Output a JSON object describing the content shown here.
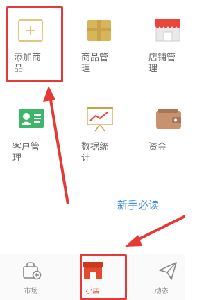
{
  "grid": {
    "items": [
      {
        "label": "添加商品",
        "icon": "add-product-icon"
      },
      {
        "label": "商品管理",
        "icon": "box-icon"
      },
      {
        "label": "店铺管理",
        "icon": "shop-icon"
      },
      {
        "label": "客户管理",
        "icon": "contact-card-icon"
      },
      {
        "label": "数据统计",
        "icon": "chart-icon"
      },
      {
        "label": "资金",
        "icon": "wallet-icon"
      }
    ]
  },
  "guide_link": "新手必读",
  "tabs": [
    {
      "label": "市场",
      "icon": "market-bag-icon",
      "active": false
    },
    {
      "label": "小店",
      "icon": "shop-icon",
      "active": true
    },
    {
      "label": "动态",
      "icon": "send-icon",
      "active": false
    }
  ],
  "colors": {
    "accent": "#e44a2c",
    "link": "#3a8ee6",
    "annotation": "#e53935",
    "gold": "#d8b45a",
    "green": "#3eb56a",
    "wallet": "#c8926e"
  }
}
